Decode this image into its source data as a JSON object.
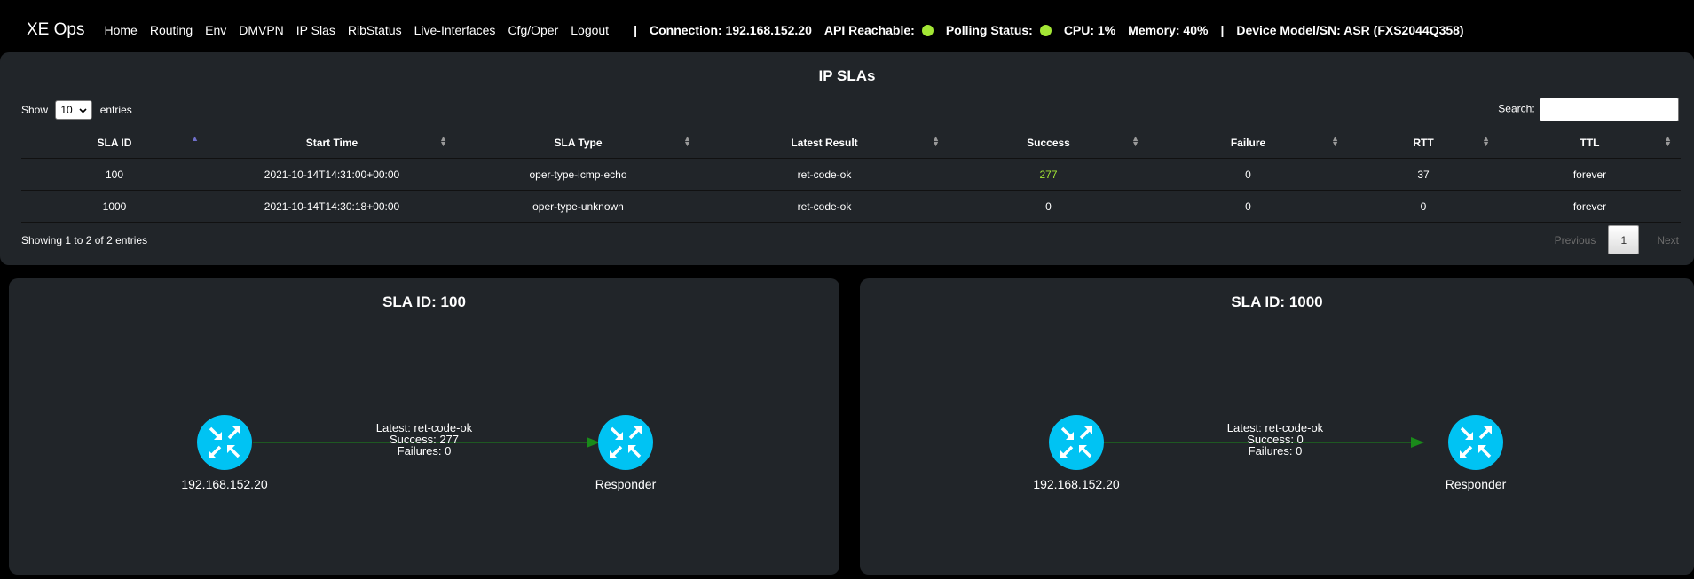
{
  "navbar": {
    "brand": "XE Ops",
    "links": [
      "Home",
      "Routing",
      "Env",
      "DMVPN",
      "IP Slas",
      "RibStatus",
      "Live-Interfaces",
      "Cfg/Oper",
      "Logout"
    ],
    "separator": "|",
    "connection": "Connection: 192.168.152.20",
    "api_reachable": "API Reachable:",
    "polling_status": "Polling Status:",
    "cpu": "CPU: 1%",
    "memory": "Memory: 40%",
    "device": "Device Model/SN: ASR (FXS2044Q358)",
    "status_color": "#a3e635"
  },
  "table": {
    "title": "IP SLAs",
    "show_label": "Show",
    "length_value": "10",
    "entries_label": "entries",
    "search_label": "Search:",
    "columns": [
      "SLA ID",
      "Start Time",
      "SLA Type",
      "Latest Result",
      "Success",
      "Failure",
      "RTT",
      "TTL"
    ],
    "rows": [
      [
        "100",
        "2021-10-14T14:31:00+00:00",
        "oper-type-icmp-echo",
        "ret-code-ok",
        "277",
        "0",
        "37",
        "forever"
      ],
      [
        "1000",
        "2021-10-14T14:30:18+00:00",
        "oper-type-unknown",
        "ret-code-ok",
        "0",
        "0",
        "0",
        "forever"
      ]
    ],
    "highlight_color": "#a3e635",
    "info": "Showing 1 to 2 of 2 entries",
    "previous": "Previous",
    "page": "1",
    "next": "Next"
  },
  "diagrams": [
    {
      "title": "SLA ID: 100",
      "source": "192.168.152.20",
      "target": "Responder",
      "latest": "Latest: ret-code-ok",
      "success": "Success: 277",
      "failures": "Failures: 0"
    },
    {
      "title": "SLA ID: 1000",
      "source": "192.168.152.20",
      "target": "Responder",
      "latest": "Latest: ret-code-ok",
      "success": "Success: 0",
      "failures": "Failures: 0"
    }
  ],
  "colors": {
    "router_icon": "#00c3f3",
    "link": "#1a8a1a"
  }
}
